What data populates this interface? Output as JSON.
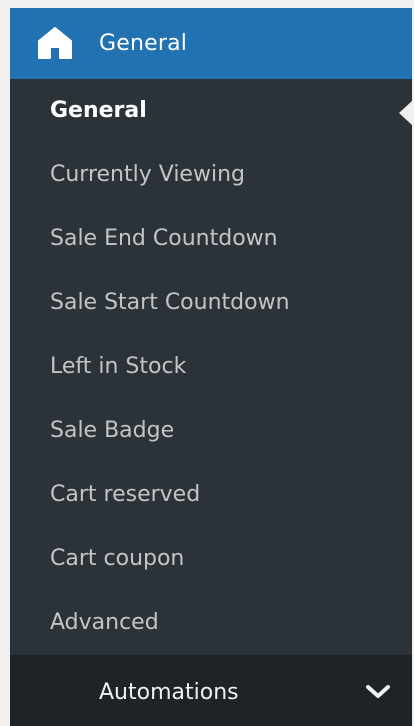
{
  "menu": {
    "header": {
      "title": "General",
      "icon": "home-icon"
    },
    "items": [
      {
        "label": "General",
        "current": true
      },
      {
        "label": "Currently Viewing",
        "current": false
      },
      {
        "label": "Sale End Countdown",
        "current": false
      },
      {
        "label": "Sale Start Countdown",
        "current": false
      },
      {
        "label": "Left in Stock",
        "current": false
      },
      {
        "label": "Sale Badge",
        "current": false
      },
      {
        "label": "Cart reserved",
        "current": false
      },
      {
        "label": "Cart coupon",
        "current": false
      },
      {
        "label": "Advanced",
        "current": false
      }
    ],
    "next_section": {
      "label": "Automations",
      "icon": "chevron-down-icon"
    }
  },
  "colors": {
    "header_bg": "#2271b1",
    "menu_bg": "#2c3338",
    "next_section_bg": "#1d2327",
    "text_muted": "#c3c4c7",
    "text_active": "#ffffff"
  }
}
